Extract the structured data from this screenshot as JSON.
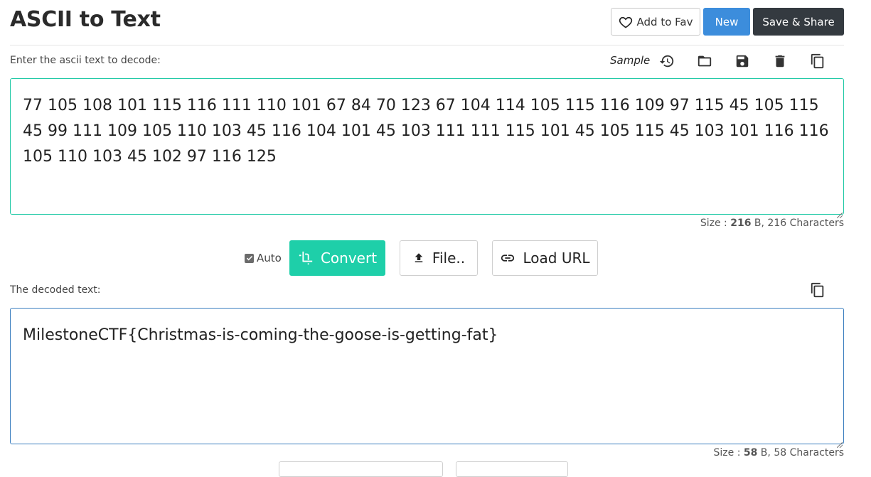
{
  "page": {
    "title": "ASCII to Text"
  },
  "header": {
    "fav_label": "Add to Fav",
    "new_label": "New",
    "save_share_label": "Save & Share"
  },
  "input": {
    "label": "Enter the ascii text to decode:",
    "sample_label": "Sample",
    "toolbar_icons": [
      "history-icon",
      "folder-open-icon",
      "save-icon",
      "delete-icon",
      "copy-icon"
    ],
    "value": "77 105 108 101 115 116 111 110 101 67 84 70 123 67 104 114 105 115 116 109 97 115 45 105 115 45 99 111 109 105 110 103 45 116 104 101 45 103 111 111 115 101 45 105 115 45 103 101 116 116 105 110 103 45 102 97 116 125",
    "size_prefix": "Size : ",
    "size_bytes": "216",
    "size_suffix": " B, 216 Characters"
  },
  "actions": {
    "auto_label": "Auto",
    "auto_checked": true,
    "convert_label": "Convert",
    "file_label": "File..",
    "load_url_label": "Load URL"
  },
  "output": {
    "label": "The decoded text:",
    "value": "MilestoneCTF{Christmas-is-coming-the-goose-is-getting-fat}",
    "size_prefix": "Size : ",
    "size_bytes": "58",
    "size_suffix": " B, 58 Characters"
  },
  "colors": {
    "accent_teal": "#1ecfa9",
    "new_blue": "#3c8ddc",
    "save_dark": "#343a40"
  }
}
